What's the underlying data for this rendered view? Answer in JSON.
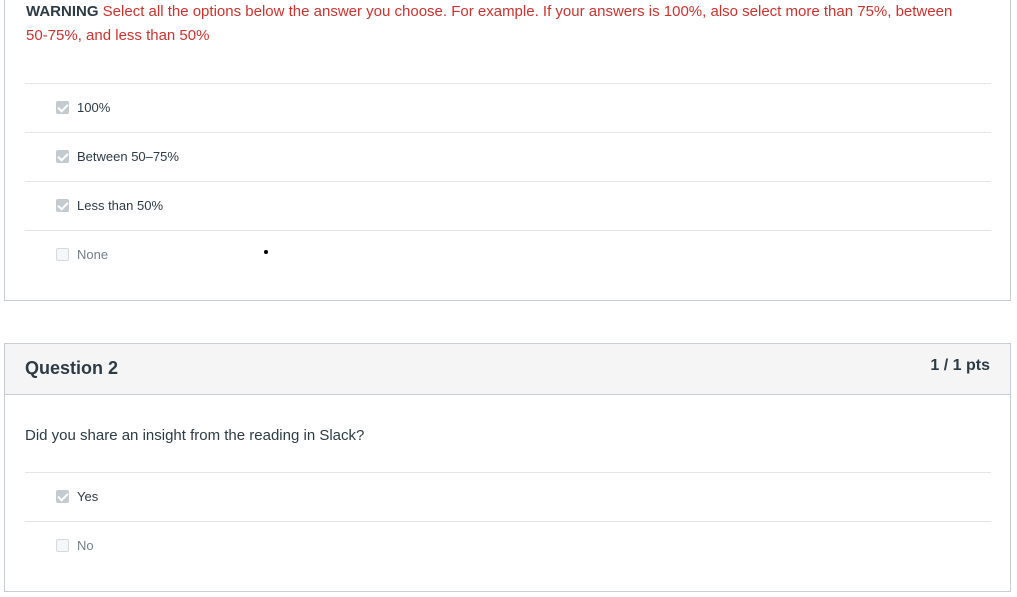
{
  "question1": {
    "warning_label": "WARNING",
    "instruction": " Select all the options below the answer you choose. For example. If your answers is 100%, also select more than 75%, between 50-75%, and less than 50%",
    "answers": [
      {
        "label": "100%",
        "checked": true
      },
      {
        "label": "Between 50–75%",
        "checked": true
      },
      {
        "label": "Less than 50%",
        "checked": true
      },
      {
        "label": "None",
        "checked": false
      }
    ]
  },
  "question2": {
    "title": "Question 2",
    "points": "1 / 1 pts",
    "text": "Did you share an insight from the reading in Slack?",
    "answers": [
      {
        "label": "Yes",
        "checked": true
      },
      {
        "label": "No",
        "checked": false
      }
    ]
  },
  "colors": {
    "warning_text": "#d0312d",
    "border": "#c7cdd1",
    "header_bg": "#f5f5f5"
  }
}
